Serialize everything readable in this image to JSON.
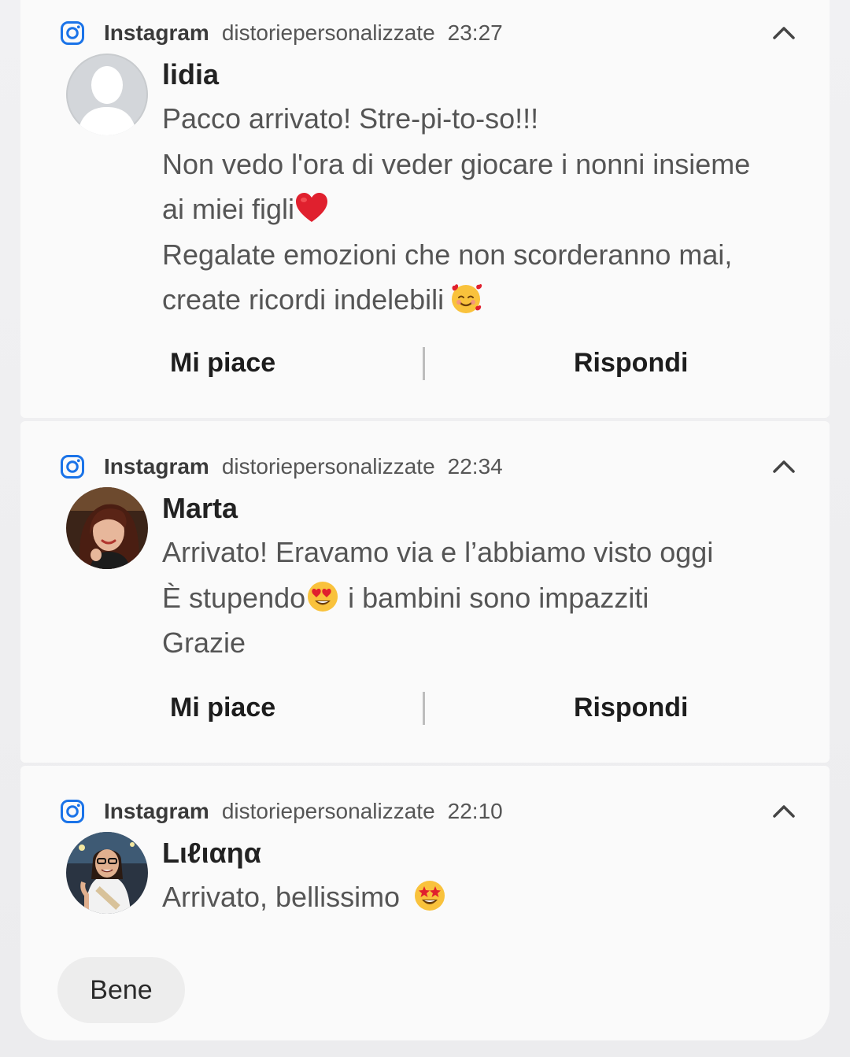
{
  "notifications": [
    {
      "app": "Instagram",
      "account": "distoriepersonalizzate",
      "time": "23:27",
      "sender": "lidia",
      "lines": [
        "Pacco arrivato! Stre-pi-to-so!!!",
        "Non vedo l'ora di veder giocare i nonni insieme",
        "ai miei figli",
        "Regalate emozioni che non scorderanno mai,",
        "create ricordi indelebili"
      ],
      "actions": {
        "like": "Mi piace",
        "reply": "Rispondi"
      }
    },
    {
      "app": "Instagram",
      "account": "distoriepersonalizzate",
      "time": "22:34",
      "sender": "Marta",
      "lines": [
        "Arrivato! Eravamo via e l’abbiamo visto oggi",
        "È stupendo",
        " i bambini sono impazziti",
        "Grazie"
      ],
      "actions": {
        "like": "Mi piace",
        "reply": "Rispondi"
      }
    },
    {
      "app": "Instagram",
      "account": "distoriepersonalizzate",
      "time": "22:10",
      "sender": "Lιℓιαηα",
      "lines": [
        "Arrivato, bellissimo "
      ],
      "quick_reply": "Bene"
    }
  ],
  "icons": {
    "app": "instagram-icon",
    "expand": "chevron-up-icon",
    "emoji_heart": "red-heart",
    "emoji_smiling_hearts": "smiling-face-with-hearts",
    "emoji_heart_eyes": "smiling-face-with-heart-eyes",
    "emoji_star_struck": "star-struck"
  },
  "colors": {
    "instagram_icon": "#1a73e8",
    "heart": "#e0202e",
    "emoji_face": "#f9c23c"
  }
}
